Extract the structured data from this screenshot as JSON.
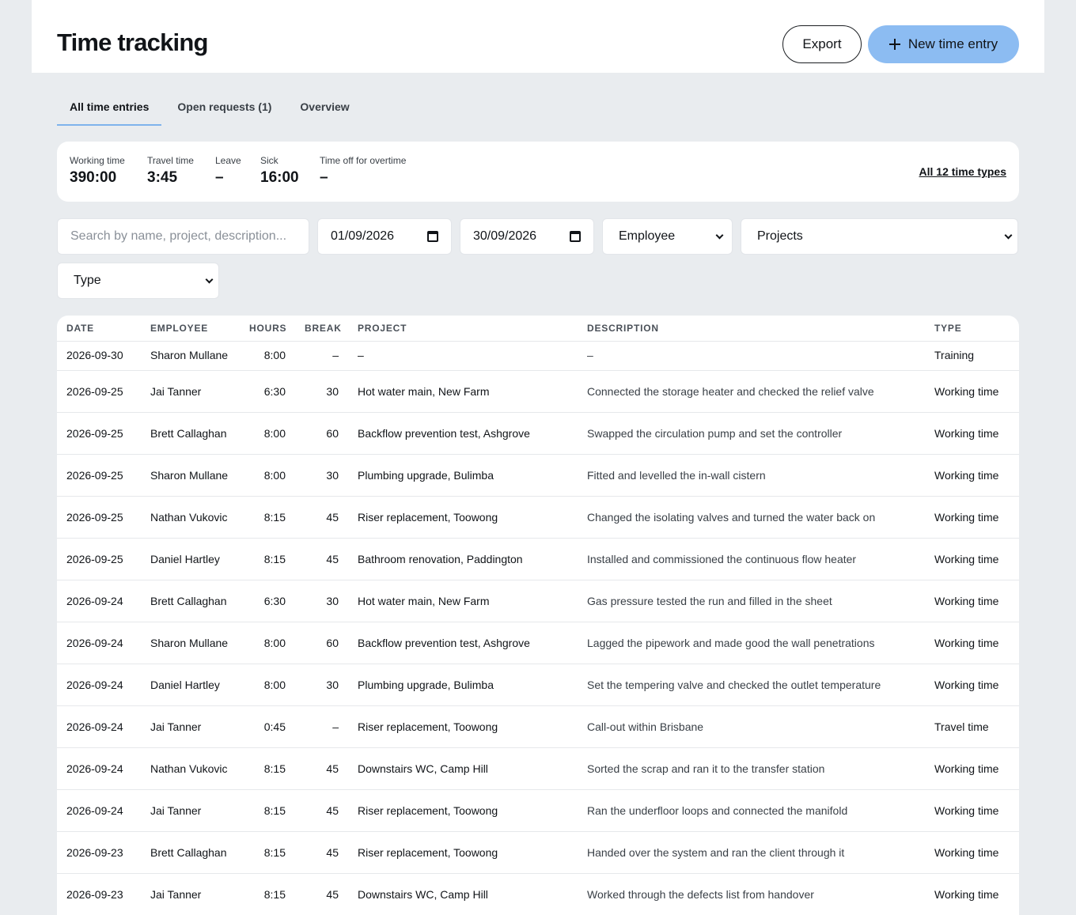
{
  "header": {
    "title": "Time tracking",
    "export_label": "Export",
    "new_entry_label": "New time entry"
  },
  "tabs": [
    {
      "label": "All time entries",
      "active": true
    },
    {
      "label": "Open requests (1)",
      "active": false
    },
    {
      "label": "Overview",
      "active": false
    }
  ],
  "summary": {
    "stats": [
      {
        "label": "Working time",
        "value": "390:00"
      },
      {
        "label": "Travel time",
        "value": "3:45"
      },
      {
        "label": "Leave",
        "value": "–"
      },
      {
        "label": "Sick",
        "value": "16:00"
      },
      {
        "label": "Time off for overtime",
        "value": "–"
      }
    ],
    "all_types_link": "All 12 time types"
  },
  "filters": {
    "search_placeholder": "Search by name, project, description...",
    "date_from": "01/09/2026",
    "date_to": "30/09/2026",
    "employee": "Employee",
    "projects": "Projects",
    "type": "Type"
  },
  "table": {
    "columns": {
      "date": "DATE",
      "employee": "EMPLOYEE",
      "hours": "HOURS",
      "break": "BREAK",
      "project": "PROJECT",
      "description": "DESCRIPTION",
      "type": "TYPE"
    },
    "rows": [
      {
        "date": "2026-09-30",
        "employee": "Sharon Mullane",
        "hours": "8:00",
        "break": "–",
        "project": "–",
        "description": "–",
        "type": "Training"
      },
      {
        "date": "2026-09-25",
        "employee": "Jai Tanner",
        "hours": "6:30",
        "break": "30",
        "project": "Hot water main, New Farm",
        "description": "Connected the storage heater and checked the relief valve",
        "type": "Working time"
      },
      {
        "date": "2026-09-25",
        "employee": "Brett Callaghan",
        "hours": "8:00",
        "break": "60",
        "project": "Backflow prevention test, Ashgrove",
        "description": "Swapped the circulation pump and set the controller",
        "type": "Working time"
      },
      {
        "date": "2026-09-25",
        "employee": "Sharon Mullane",
        "hours": "8:00",
        "break": "30",
        "project": "Plumbing upgrade, Bulimba",
        "description": "Fitted and levelled the in-wall cistern",
        "type": "Working time"
      },
      {
        "date": "2026-09-25",
        "employee": "Nathan Vukovic",
        "hours": "8:15",
        "break": "45",
        "project": "Riser replacement, Toowong",
        "description": "Changed the isolating valves and turned the water back on",
        "type": "Working time"
      },
      {
        "date": "2026-09-25",
        "employee": "Daniel Hartley",
        "hours": "8:15",
        "break": "45",
        "project": "Bathroom renovation, Paddington",
        "description": "Installed and commissioned the continuous flow heater",
        "type": "Working time"
      },
      {
        "date": "2026-09-24",
        "employee": "Brett Callaghan",
        "hours": "6:30",
        "break": "30",
        "project": "Hot water main, New Farm",
        "description": "Gas pressure tested the run and filled in the sheet",
        "type": "Working time"
      },
      {
        "date": "2026-09-24",
        "employee": "Sharon Mullane",
        "hours": "8:00",
        "break": "60",
        "project": "Backflow prevention test, Ashgrove",
        "description": "Lagged the pipework and made good the wall penetrations",
        "type": "Working time"
      },
      {
        "date": "2026-09-24",
        "employee": "Daniel Hartley",
        "hours": "8:00",
        "break": "30",
        "project": "Plumbing upgrade, Bulimba",
        "description": "Set the tempering valve and checked the outlet temperature",
        "type": "Working time"
      },
      {
        "date": "2026-09-24",
        "employee": "Jai Tanner",
        "hours": "0:45",
        "break": "–",
        "project": "Riser replacement, Toowong",
        "description": "Call-out within Brisbane",
        "type": "Travel time"
      },
      {
        "date": "2026-09-24",
        "employee": "Nathan Vukovic",
        "hours": "8:15",
        "break": "45",
        "project": "Downstairs WC, Camp Hill",
        "description": "Sorted the scrap and ran it to the transfer station",
        "type": "Working time"
      },
      {
        "date": "2026-09-24",
        "employee": "Jai Tanner",
        "hours": "8:15",
        "break": "45",
        "project": "Riser replacement, Toowong",
        "description": "Ran the underfloor loops and connected the manifold",
        "type": "Working time"
      },
      {
        "date": "2026-09-23",
        "employee": "Brett Callaghan",
        "hours": "8:15",
        "break": "45",
        "project": "Riser replacement, Toowong",
        "description": "Handed over the system and ran the client through it",
        "type": "Working time"
      },
      {
        "date": "2026-09-23",
        "employee": "Jai Tanner",
        "hours": "8:15",
        "break": "45",
        "project": "Downstairs WC, Camp Hill",
        "description": "Worked through the defects list from handover",
        "type": "Working time"
      }
    ]
  }
}
